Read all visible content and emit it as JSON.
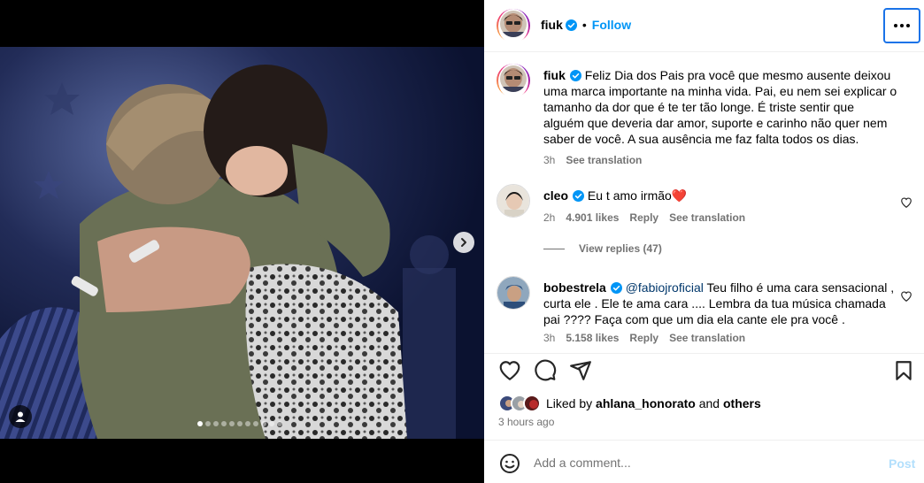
{
  "post_author": {
    "username": "fiuk",
    "follow_label": "Follow",
    "separator": "•"
  },
  "caption": {
    "username": "fiuk",
    "text": "Feliz Dia dos Pais pra você que mesmo ausente deixou uma marca importante na minha vida. Pai, eu nem sei explicar o tamanho da dor que é te ter tão longe. É triste sentir que alguém que deveria dar amor, suporte e carinho não quer nem saber de você. A sua ausência me faz falta todos os dias.",
    "time": "3h",
    "see_translation": "See translation"
  },
  "comments": [
    {
      "username": "cleo",
      "text": "Eu t amo irmão❤️",
      "time": "2h",
      "likes": "4.901 likes",
      "reply": "Reply",
      "see_translation": "See translation",
      "view_replies": "View replies (47)"
    },
    {
      "username": "bobestrela",
      "mention": "@fabiojroficial",
      "text": " Teu filho é uma cara sensacional , curta ele . Ele te ama cara .... Lembra da tua música chamada pai ???? Faça com que um dia ela cante ele pra você .",
      "time": "3h",
      "likes": "5.158 likes",
      "reply": "Reply",
      "see_translation": "See translation"
    }
  ],
  "likes": {
    "prefix": "Liked by",
    "user": "ahlana_honorato",
    "conj": "and",
    "others": "others"
  },
  "timestamp": "3 hours ago",
  "add_comment": {
    "placeholder": "Add a comment...",
    "post_label": "Post"
  },
  "carousel": {
    "total": 9,
    "active_index": 0
  },
  "colors": {
    "link_blue": "#0095f6",
    "mention": "#00376b",
    "muted": "#737373",
    "post_disabled": "#b2dffc"
  },
  "icons": [
    "verified-badge-icon",
    "more-options-icon",
    "heart-icon",
    "comment-icon",
    "share-icon",
    "bookmark-icon",
    "emoji-icon",
    "chevron-right-icon",
    "user-tag-icon"
  ]
}
